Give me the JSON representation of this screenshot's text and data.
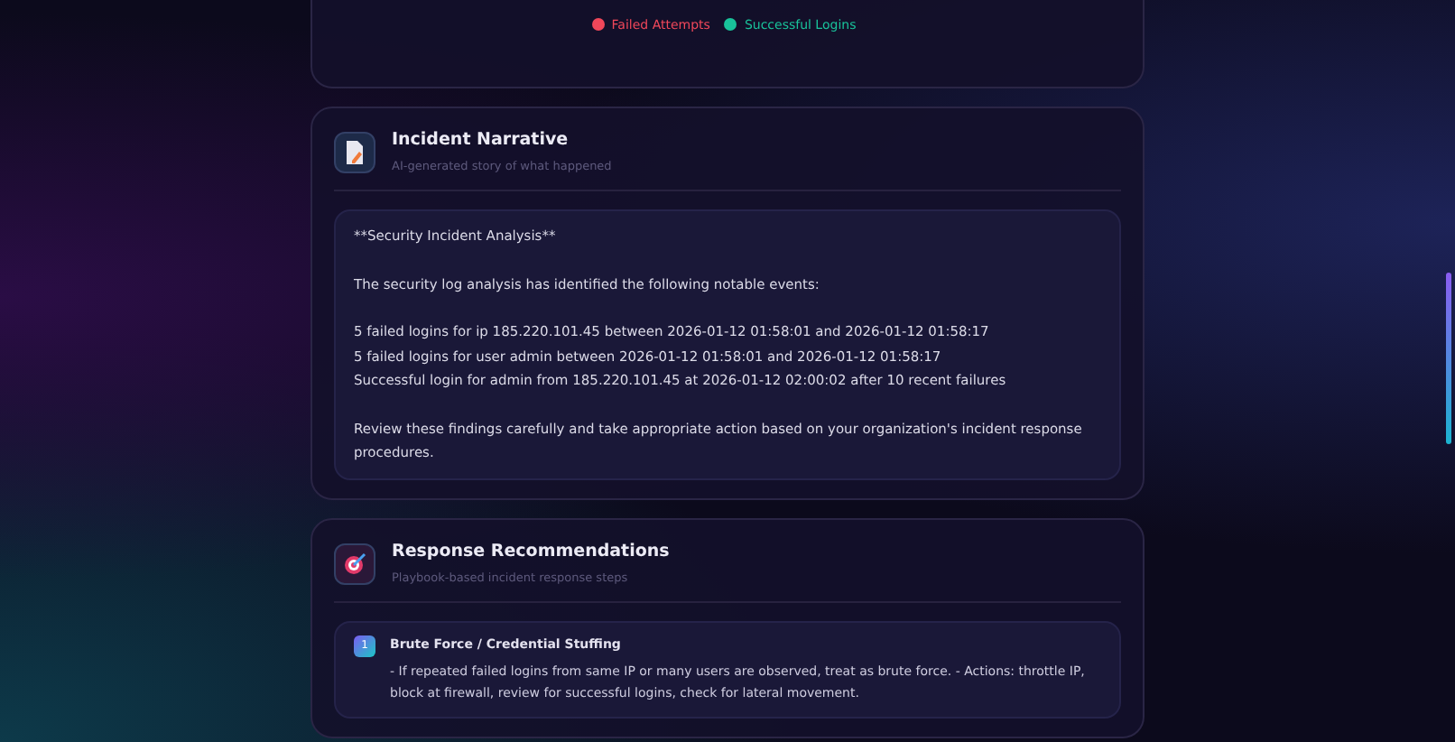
{
  "chart_card": {
    "legend": [
      {
        "label": "Failed Attempts",
        "color": "#f0475a"
      },
      {
        "label": "Successful Logins",
        "color": "#19c29a"
      }
    ]
  },
  "narrative": {
    "title": "Incident Narrative",
    "subtitle": "AI-generated story of what happened",
    "paragraphs": [
      {
        "lines": [
          "**Security Incident Analysis**"
        ]
      },
      {
        "lines": [
          "The security log analysis has identified the following notable events:"
        ]
      },
      {
        "lines": [
          "5 failed logins for ip 185.220.101.45 between 2026-01-12 01:58:01 and 2026-01-12 01:58:17",
          "5 failed logins for user admin between 2026-01-12 01:58:01 and 2026-01-12 01:58:17",
          "Successful login for admin from 185.220.101.45 at 2026-01-12 02:00:02 after 10 recent failures"
        ]
      },
      {
        "lines": [
          "Review these findings carefully and take appropriate action based on your organization's incident response procedures."
        ]
      }
    ]
  },
  "recommendations": {
    "title": "Response Recommendations",
    "subtitle": "Playbook-based incident response steps",
    "items": [
      {
        "number": "1",
        "title": "Brute Force / Credential Stuffing",
        "text": "- If repeated failed logins from same IP or many users are observed, treat as brute force. - Actions: throttle IP, block at firewall, review for successful logins, check for lateral movement."
      }
    ]
  }
}
